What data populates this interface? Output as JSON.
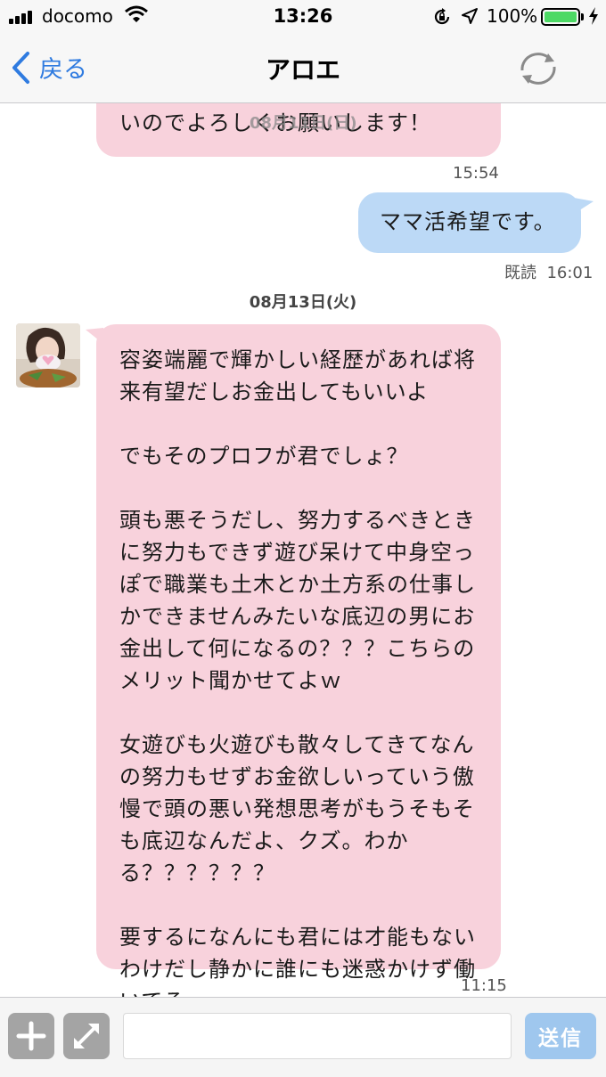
{
  "status_bar": {
    "carrier": "docomo",
    "time": "13:26",
    "battery_percent": "100%",
    "battery_level": 1.0
  },
  "nav": {
    "back_label": "戻る",
    "title": "アロエ",
    "back_icon": "chevron-left-icon",
    "refresh_icon": "refresh-icon"
  },
  "messages": {
    "partial_text": "との利き合的これでこうして\nいのでよろしくお願いします！",
    "partial_overlay_date": "08月11日(日)",
    "partial_time": "15:54",
    "outgoing_text": "ママ活希望です。",
    "outgoing_read": "既読",
    "outgoing_time": "16:01",
    "date_separator": "08月13日(火)",
    "incoming_text": "容姿端麗で輝かしい経歴があれば将\n来有望だしお金出してもいいよ\n\nでもそのプロフが君でしょ？\n\n頭も悪そうだし、努力するべきとき\nに努力もできず遊び呆けて中身空っ\nぽで職業も土木とか土方系の仕事し\nかできませんみたいな底辺の男にお\n金出して何になるの？？？こちらの\nメリット聞かせてよｗ\n\n女遊びも火遊びも散々してきてなん\nの努力もせずお金欲しいっていう傲\n慢で頭の悪い発想思考がもうそもそ\nも底辺なんだよ、クズ。わか\nる？？？？？？\n\n要するになんにも君には才能もない\nわけだし静かに誰にも迷惑かけず働\nいてろ",
    "incoming_time": "11:15"
  },
  "input_bar": {
    "placeholder": "",
    "send_label": "送信",
    "plus_icon": "plus-icon",
    "expand_icon": "expand-icon"
  },
  "colors": {
    "incoming_bubble": "#f8d2dc",
    "outgoing_bubble": "#bcd9f6",
    "accent": "#2f7be0",
    "battery": "#4cd964"
  }
}
